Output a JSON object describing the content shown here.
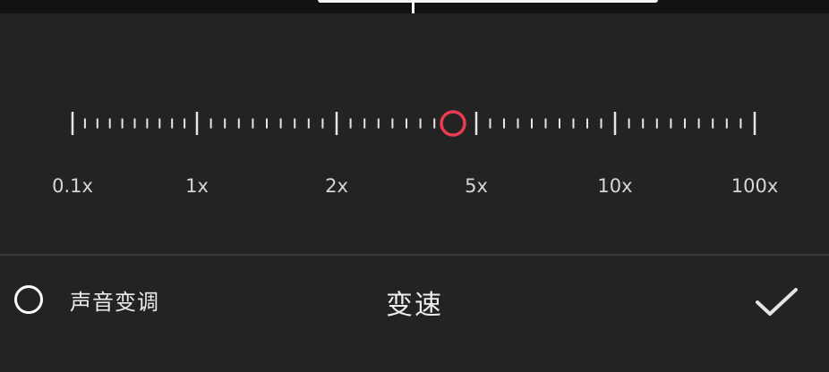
{
  "speed": {
    "labels": [
      "0.1x",
      "1x",
      "2x",
      "5x",
      "10x",
      "100x"
    ],
    "current_value": "4.6x"
  },
  "bottom": {
    "pitch_toggle_label": "声音变调",
    "title": "变速"
  },
  "icons": {
    "confirm": "checkmark-icon",
    "radio": "radio-unchecked-icon"
  },
  "colors": {
    "accent": "#ea3b53",
    "background": "#232323"
  }
}
